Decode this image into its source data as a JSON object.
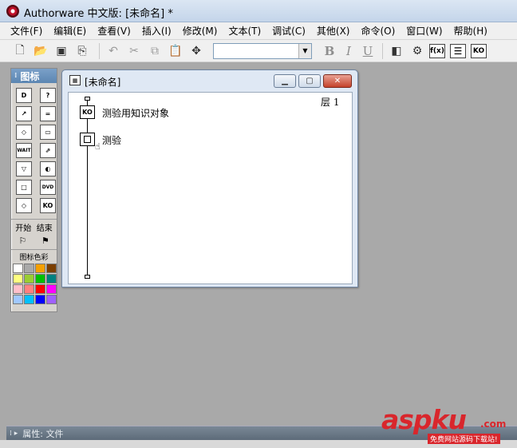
{
  "window": {
    "title": "Authorware 中文版: [未命名] *"
  },
  "menu": [
    "文件(F)",
    "编辑(E)",
    "查看(V)",
    "插入(I)",
    "修改(M)",
    "文本(T)",
    "调试(C)",
    "其他(X)",
    "命令(O)",
    "窗口(W)",
    "帮助(H)"
  ],
  "toolbar": {
    "font_combo_value": "",
    "bold": "B",
    "italic": "I",
    "underline": "U",
    "fx": "f(x)",
    "ko": "KO"
  },
  "palette": {
    "title": "图标",
    "icons": [
      {
        "name": "display-icon",
        "glyph": "D"
      },
      {
        "name": "interaction-icon",
        "glyph": "?"
      },
      {
        "name": "motion-icon",
        "glyph": "↗"
      },
      {
        "name": "calc-icon",
        "glyph": "="
      },
      {
        "name": "erase-icon",
        "glyph": "◇"
      },
      {
        "name": "video-icon",
        "glyph": "▭"
      },
      {
        "name": "wait-icon",
        "glyph": "WAIT"
      },
      {
        "name": "navigate-icon",
        "glyph": "⇗"
      },
      {
        "name": "decision-icon",
        "glyph": "▽"
      },
      {
        "name": "sound-icon",
        "glyph": "◐"
      },
      {
        "name": "map-icon",
        "glyph": "□"
      },
      {
        "name": "dvd-icon",
        "glyph": "DVD"
      },
      {
        "name": "framework-icon",
        "glyph": "◇"
      },
      {
        "name": "knowledge-object-icon",
        "glyph": "KO"
      }
    ],
    "start_label": "开始",
    "end_label": "结束",
    "color_label": "图标色彩",
    "colors": [
      "#ffffff",
      "#a9a9a9",
      "#f5a000",
      "#7b3f00",
      "#ffff80",
      "#9acd32",
      "#00c000",
      "#008080",
      "#ffc0cb",
      "#ff8080",
      "#ff0000",
      "#ff00ff",
      "#a0c8ff",
      "#00c0ff",
      "#0000ff",
      "#a060ff"
    ]
  },
  "flow_window": {
    "title": "[未命名]",
    "layer": "层 1",
    "nodes": [
      {
        "label": "测验用知识对象",
        "glyph": "KO"
      },
      {
        "label": "测验"
      }
    ]
  },
  "properties": {
    "label": "属性: 文件"
  },
  "watermark": {
    "main": "aspku",
    "suffix": ".com",
    "sub": "免费网站源码下载站!"
  }
}
